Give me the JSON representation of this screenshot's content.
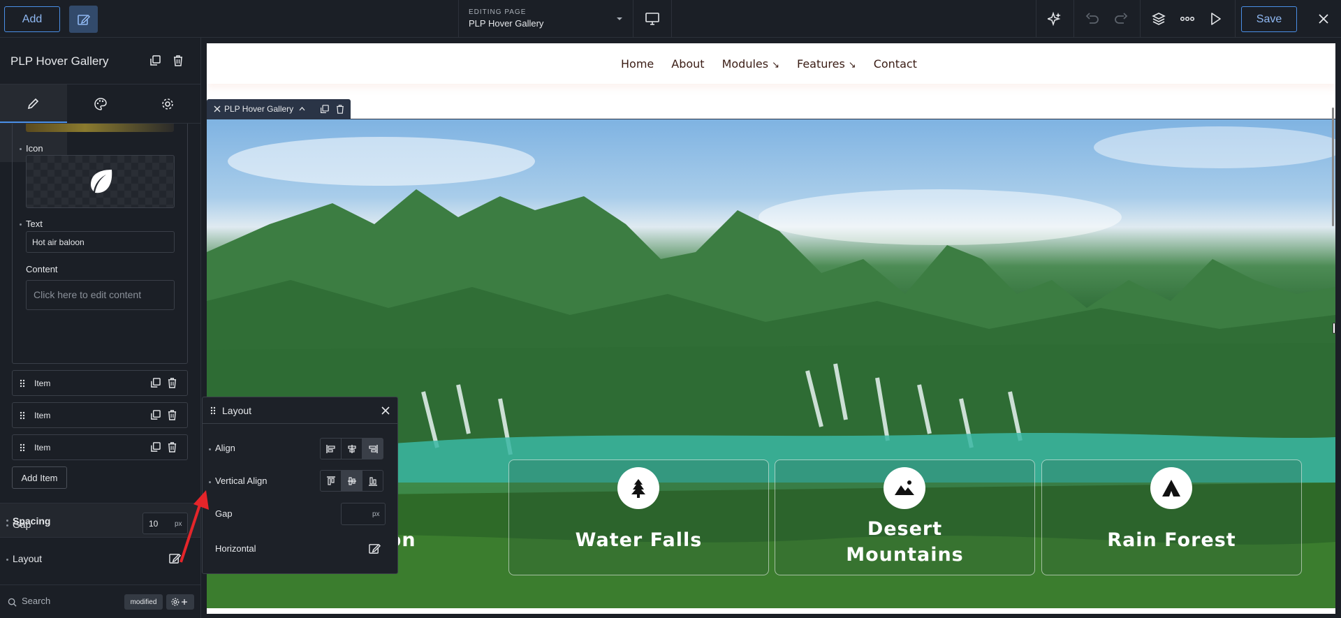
{
  "topbar": {
    "add_label": "Add",
    "editing_caption": "EDITING PAGE",
    "page_name": "PLP Hover Gallery",
    "save_label": "Save"
  },
  "panel": {
    "title": "PLP Hover Gallery",
    "icon_label": "Icon",
    "text_label": "Text",
    "text_value": "Hot air baloon",
    "content_label": "Content",
    "content_placeholder": "Click here to edit content",
    "items": [
      "Item",
      "Item",
      "Item"
    ],
    "add_item_label": "Add Item",
    "spacing_label": "Spacing",
    "gap_label": "Gap",
    "gap_value": "10",
    "gap_unit": "px",
    "layout_label": "Layout",
    "search_placeholder": "Search",
    "modified_badge": "modified"
  },
  "layout_popup": {
    "title": "Layout",
    "align_label": "Align",
    "valign_label": "Vertical Align",
    "gap_label": "Gap",
    "gap_unit": "px",
    "horizontal_label": "Horizontal"
  },
  "site": {
    "nav": [
      "Home",
      "About",
      "Modules",
      "Features",
      "Contact"
    ],
    "module_tag": "PLP Hover Gallery",
    "cards": [
      {
        "title": "loon",
        "icon": "balloon-icon"
      },
      {
        "title": "Water Falls",
        "icon": "tree-icon"
      },
      {
        "title_line1": "Desert",
        "title_line2": "Mountains",
        "icon": "mountain-image-icon"
      },
      {
        "title": "Rain Forest",
        "icon": "tent-icon"
      }
    ]
  },
  "colors": {
    "accent": "#4a8fe7",
    "annotation_arrow": "#e5252a",
    "nav_text": "#3a1c14"
  }
}
